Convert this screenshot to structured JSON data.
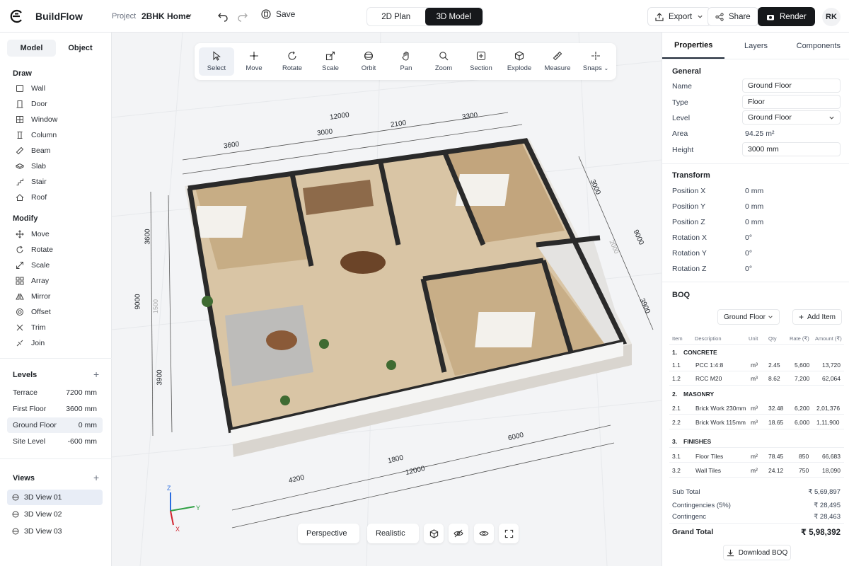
{
  "app": {
    "name": "BuildFlow",
    "project_label": "Project",
    "project_name": "2BHK Home",
    "save_label": "Save",
    "avatar": "RK"
  },
  "view_modes": {
    "plan": "2D Plan",
    "model": "3D Model"
  },
  "header_actions": {
    "export": "Export",
    "share": "Share",
    "render": "Render"
  },
  "left": {
    "tabs": [
      "Model",
      "Object"
    ],
    "draw_title": "Draw",
    "draw_items": [
      "Wall",
      "Door",
      "Window",
      "Column",
      "Beam",
      "Slab",
      "Stair",
      "Roof"
    ],
    "modify_title": "Modify",
    "modify_items": [
      "Move",
      "Rotate",
      "Scale",
      "Array",
      "Mirror",
      "Offset",
      "Trim",
      "Join"
    ],
    "levels_title": "Levels",
    "levels": [
      {
        "name": "Terrace",
        "value": "7200 mm"
      },
      {
        "name": "First Floor",
        "value": "3600 mm"
      },
      {
        "name": "Ground Floor",
        "value": "0 mm"
      },
      {
        "name": "Site Level",
        "value": "-600 mm"
      }
    ],
    "views_title": "Views",
    "views": [
      "3D View 01",
      "3D View 02",
      "3D View 03"
    ]
  },
  "toolbar": [
    "Select",
    "Move",
    "Rotate",
    "Scale",
    "Orbit",
    "Pan",
    "Zoom",
    "Section",
    "Explode",
    "Measure",
    "Snaps"
  ],
  "dimensions": {
    "top_total": "12000",
    "top_a": "3600",
    "top_b": "3000",
    "top_c": "2100",
    "top_d": "3300",
    "left_total": "9000",
    "left_a": "3600",
    "left_b": "3900",
    "left_c": "1500",
    "right_a": "3000",
    "right_total": "9000",
    "right_b": "3900",
    "right_c": "2000",
    "bottom_total": "12000",
    "bottom_a": "4200",
    "bottom_b": "1800",
    "bottom_c": "6000"
  },
  "axes": {
    "z": "Z",
    "y": "Y",
    "x": "X"
  },
  "bottom_controls": {
    "camera": "Perspective",
    "style": "Realistic"
  },
  "right": {
    "tabs": [
      "Properties",
      "Layers",
      "Components"
    ],
    "general_title": "General",
    "general": [
      {
        "label": "Name",
        "value": "Ground Floor",
        "box": true
      },
      {
        "label": "Type",
        "value": "Floor",
        "box": true
      },
      {
        "label": "Level",
        "value": "Ground Floor",
        "box": true
      },
      {
        "label": "Area",
        "value": "94.25 m²",
        "box": false
      },
      {
        "label": "Height",
        "value": "3000 mm",
        "box": true
      }
    ],
    "transform_title": "Transform",
    "transform": [
      {
        "label": "Position X",
        "value": "0 mm"
      },
      {
        "label": "Position Y",
        "value": "0 mm"
      },
      {
        "label": "Position Z",
        "value": "0 mm"
      },
      {
        "label": "Rotation X",
        "value": "0°"
      },
      {
        "label": "Rotation Y",
        "value": "0°"
      },
      {
        "label": "Rotation Z",
        "value": "0°"
      }
    ],
    "boq_title": "BOQ",
    "boq_filter": "Ground Floor",
    "boq_add": "Add Item",
    "boq_headers": [
      "Item",
      "Description",
      "Unit",
      "Qty",
      "Rate (₹)",
      "Amount (₹)"
    ],
    "boq_groups": [
      {
        "no": "1.",
        "name": "CONCRETE",
        "rows": [
          {
            "item": "1.1",
            "desc": "PCC 1:4:8",
            "unit": "m³",
            "qty": "2.45",
            "rate": "5,600",
            "amount": "13,720"
          },
          {
            "item": "1.2",
            "desc": "RCC M20",
            "unit": "m³",
            "qty": "8.62",
            "rate": "7,200",
            "amount": "62,064"
          }
        ]
      },
      {
        "no": "2.",
        "name": "MASONRY",
        "rows": [
          {
            "item": "2.1",
            "desc": "Brick Work 230mm",
            "unit": "m³",
            "qty": "32.48",
            "rate": "6,200",
            "amount": "2,01,376"
          },
          {
            "item": "2.2",
            "desc": "Brick Work 115mm",
            "unit": "m³",
            "qty": "18.65",
            "rate": "6,000",
            "amount": "1,11,900"
          }
        ]
      },
      {
        "no": "3.",
        "name": "FINISHES",
        "rows": [
          {
            "item": "3.1",
            "desc": "Floor Tiles",
            "unit": "m²",
            "qty": "78.45",
            "rate": "850",
            "amount": "66,683"
          },
          {
            "item": "3.2",
            "desc": "Wall Tiles",
            "unit": "m²",
            "qty": "24.12",
            "rate": "750",
            "amount": "18,090"
          }
        ]
      }
    ],
    "summary": [
      {
        "label": "Sub Total",
        "value": "₹ 5,69,897"
      },
      {
        "label": "Contingencies (5%)",
        "value": "₹ 28,495"
      },
      {
        "label": "Contingenc",
        "value": "₹ 28,463"
      }
    ],
    "grand_label": "Grand Total",
    "grand_value": "₹ 5,98,392",
    "download": "Download BOQ"
  }
}
